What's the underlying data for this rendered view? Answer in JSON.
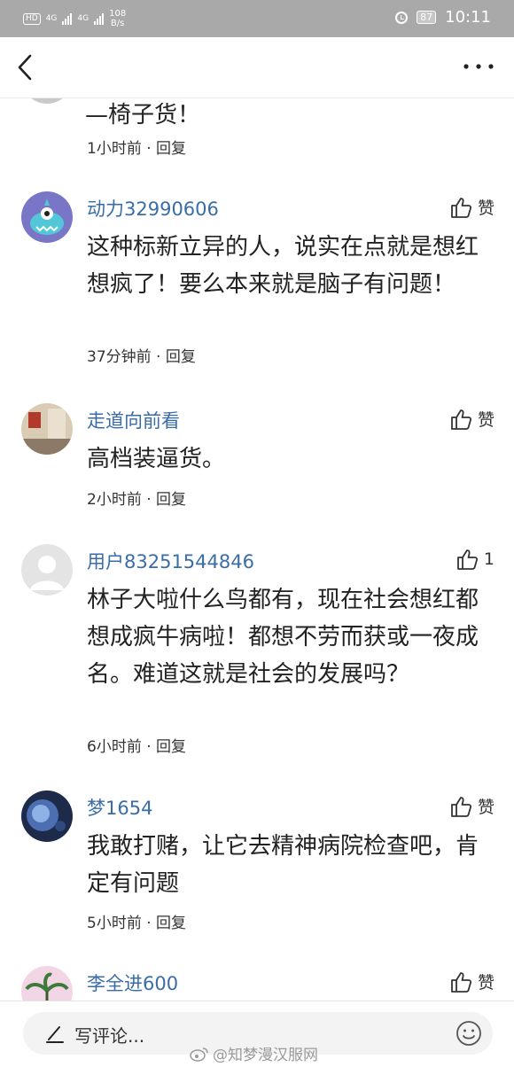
{
  "status_bar": {
    "hd": "HD",
    "signal1": "4G",
    "signal2": "4G",
    "net_speed_value": "108",
    "net_speed_unit": "B/s",
    "battery": "87",
    "time": "10:11"
  },
  "partial_comment": {
    "text": "—椅子货！",
    "meta": "1小时前 · 回复"
  },
  "comments": [
    {
      "username": "动力32990606",
      "like": "赞",
      "text": "这种标新立异的人，说实在点就是想红想疯了！要么本来就是脑子有问题！",
      "meta": "37分钟前 · 回复"
    },
    {
      "username": "走道向前看",
      "like": "赞",
      "text": "高档装逼货。",
      "meta": "2小时前 · 回复"
    },
    {
      "username": "用户83251544846",
      "like": "1",
      "text": "林子大啦什么鸟都有，现在社会想红都想成疯牛病啦！都想不劳而获或一夜成名。难道这就是社会的发展吗？",
      "meta": "6小时前 · 回复"
    },
    {
      "username": "梦1654",
      "like": "赞",
      "text": "我敢打赌，让它去精神病院检查吧，肯定有问题",
      "meta": "5小时前 · 回复"
    },
    {
      "username": "李全进600",
      "like": "赞"
    }
  ],
  "bottom_bar": {
    "placeholder": "写评论..."
  },
  "watermark": "@知梦漫汉服网"
}
